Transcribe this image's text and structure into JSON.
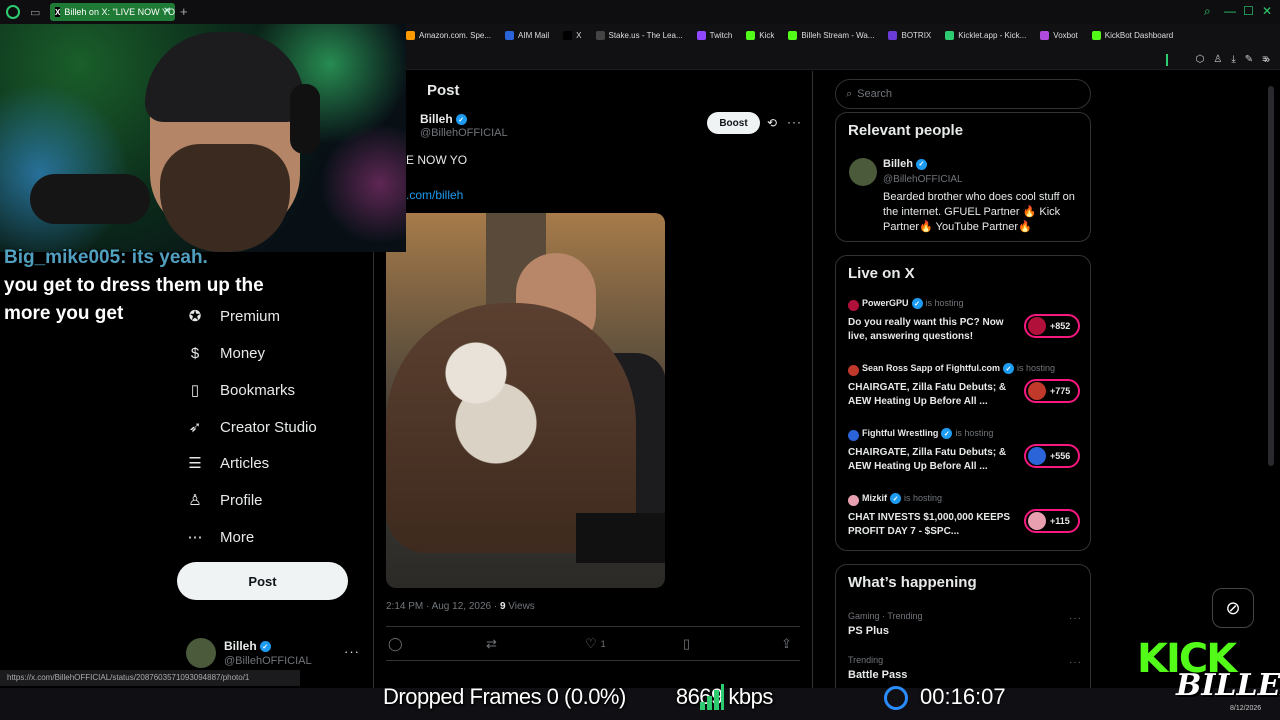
{
  "browser": {
    "active_tab_title": "Billeh on X: \"LIVE NOW YO",
    "bookmarks": [
      {
        "label": "Amazon.com. Spe...",
        "color": "#ff9900"
      },
      {
        "label": "AIM Mail",
        "color": "#2a64d8"
      },
      {
        "label": "X",
        "color": "#000000"
      },
      {
        "label": "Stake.us - The Lea...",
        "color": "#444444"
      },
      {
        "label": "Twitch",
        "color": "#9146ff"
      },
      {
        "label": "Kick",
        "color": "#53fc18"
      },
      {
        "label": "Billeh Stream - Wa...",
        "color": "#53fc18"
      },
      {
        "label": "BOTRIX",
        "color": "#6b3bd8"
      },
      {
        "label": "Kicklet.app - Kick...",
        "color": "#2ecc71"
      },
      {
        "label": "Voxbot",
        "color": "#b04be0"
      },
      {
        "label": "KickBot Dashboard",
        "color": "#53fc18"
      }
    ],
    "status_url": "https://x.com/BillehOFFICIAL/status/2087603571093094887/photo/1"
  },
  "chat_overlay": {
    "username": "Big_mike005:",
    "message_partial": "its yeah.",
    "lines": [
      "you get to dress them up the",
      "more you get"
    ]
  },
  "nav": {
    "items": [
      {
        "label": "Premium",
        "icon": "verified-badge-icon",
        "glyph": "✪"
      },
      {
        "label": "Money",
        "icon": "money-icon",
        "glyph": "$"
      },
      {
        "label": "Bookmarks",
        "icon": "bookmark-icon",
        "glyph": "▯"
      },
      {
        "label": "Creator Studio",
        "icon": "rocket-icon",
        "glyph": "➶"
      },
      {
        "label": "Articles",
        "icon": "articles-icon",
        "glyph": "☰"
      },
      {
        "label": "Profile",
        "icon": "profile-icon",
        "glyph": "♙"
      },
      {
        "label": "More",
        "icon": "more-circle-icon",
        "glyph": "⋯"
      }
    ],
    "post_button": "Post",
    "account": {
      "name": "Billeh",
      "handle": "@BillehOFFICIAL"
    }
  },
  "post": {
    "header": "Post",
    "author_name": "Billeh",
    "author_handle": "@BillehOFFICIAL",
    "boost_label": "Boost",
    "text": "E NOW YO",
    "link": ".com/billeh",
    "meta_time": "2:14 PM · Aug 12, 2026 · ",
    "meta_views_count": "9",
    "meta_views_label": " Views",
    "like_count": "1"
  },
  "sidebar": {
    "search_placeholder": "Search",
    "relevant_title": "Relevant people",
    "relevant_person": {
      "name": "Billeh",
      "handle": "@BillehOFFICIAL",
      "bio": "Bearded brother who does cool stuff on the internet. GFUEL Partner 🔥 Kick Partner🔥 YouTube Partner🔥"
    },
    "live_title": "Live on X",
    "live_items": [
      {
        "host": "PowerGPU",
        "hosting": "is hosting",
        "title": "Do you really want this PC? Now live, answering questions!",
        "count": "+852",
        "color": "#b0103a"
      },
      {
        "host": "Sean Ross Sapp of Fightful.com",
        "hosting": "is hosting",
        "title": "CHAIRGATE, Zilla Fatu Debuts; & AEW Heating Up Before All ...",
        "count": "+775",
        "color": "#c0392b"
      },
      {
        "host": "Fightful Wrestling",
        "hosting": "is hosting",
        "title": "CHAIRGATE, Zilla Fatu Debuts; & AEW Heating Up Before All ...",
        "count": "+556",
        "color": "#2a64d8"
      },
      {
        "host": "Mizkif",
        "hosting": "is hosting",
        "title": "CHAT INVESTS $1,000,000 KEEPS PROFIT DAY 7 - $SPC...",
        "count": "+115",
        "color": "#e8a0b0"
      }
    ],
    "happening_title": "What’s happening",
    "trends": [
      {
        "category": "Gaming · Trending",
        "name": "PS Plus"
      },
      {
        "category": "Trending",
        "name": "Battle Pass"
      }
    ]
  },
  "stream": {
    "dropped_frames": "Dropped Frames 0 (0.0%)",
    "bitrate": "8669 kbps",
    "timer": "00:16:07",
    "brand_logo": "KICK",
    "signature": "BILLEH",
    "tray_date": "8/12/2026"
  },
  "colors": {
    "accent": "#1d9bf0",
    "kick_green": "#53fc18",
    "live_ring": "#f91880"
  }
}
